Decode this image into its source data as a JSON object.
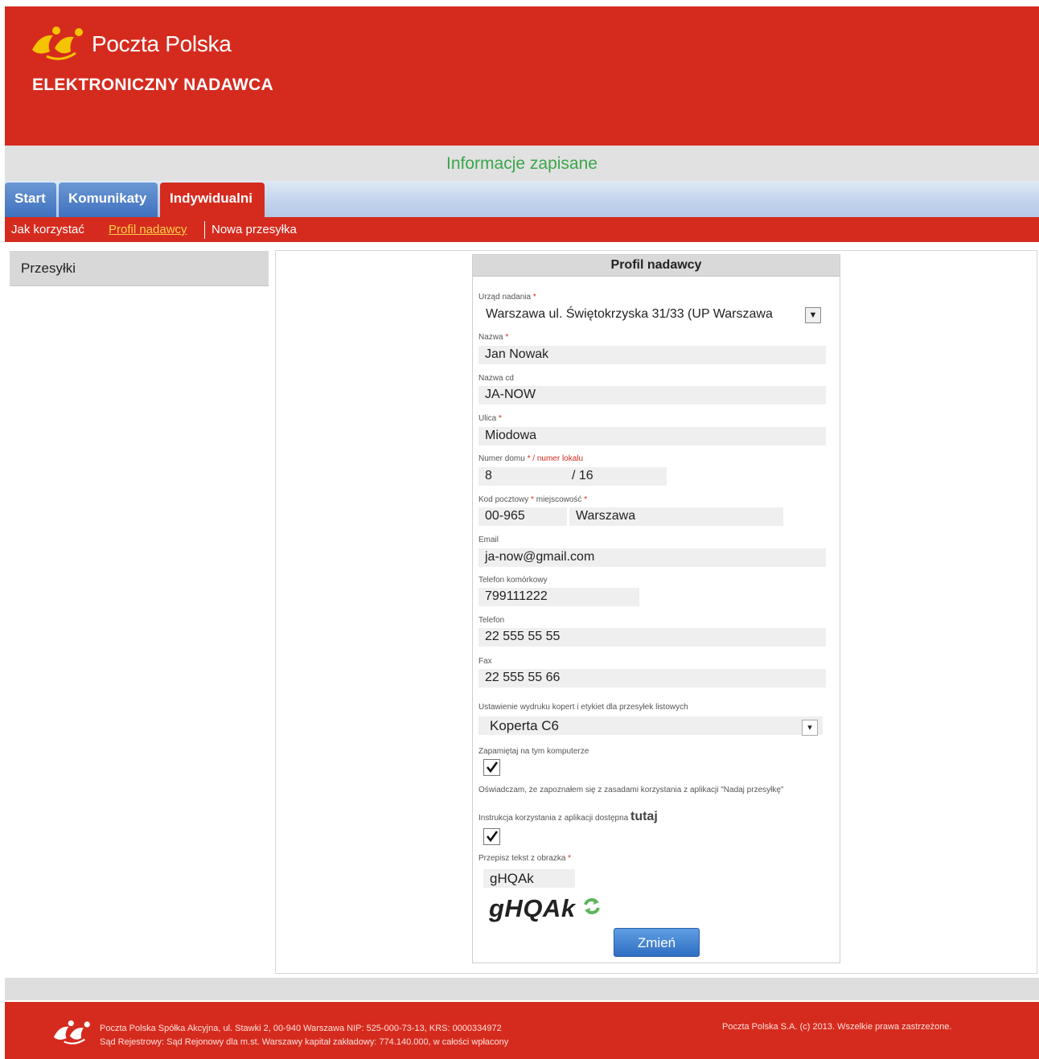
{
  "header": {
    "brand_name": "Poczta Polska",
    "app_title": "ELEKTRONICZNY NADAWCA"
  },
  "status": {
    "message": "Informacje zapisane"
  },
  "tabs": [
    {
      "label": "Start"
    },
    {
      "label": "Komunikaty"
    },
    {
      "label": "Indywidualni",
      "active": true
    }
  ],
  "subnav": [
    {
      "label": "Jak korzystać"
    },
    {
      "label": "Profil nadawcy",
      "active": true
    },
    {
      "label": "Nowa przesyłka"
    }
  ],
  "sidebar": {
    "title": "Przesyłki"
  },
  "form": {
    "title": "Profil nadawcy",
    "urzad": {
      "label": "Urząd nadania",
      "value": "Warszawa ul. Świętokrzyska 31/33 (UP Warszawa"
    },
    "nazwa": {
      "label": "Nazwa",
      "value": "Jan Nowak"
    },
    "nazwa_cd": {
      "label": "Nazwa cd",
      "value": "JA-NOW"
    },
    "ulica": {
      "label": "Ulica",
      "value": "Miodowa"
    },
    "numer": {
      "label_a": "Numer domu",
      "label_b": "/ numer lokalu",
      "dom": "8",
      "lokal": "16",
      "slash": "/"
    },
    "kod": {
      "label_a": "Kod pocztowy",
      "label_b": "miejscowość",
      "kod": "00-965",
      "miejscowosc": "Warszawa"
    },
    "email": {
      "label": "Email",
      "value": "ja-now@gmail.com"
    },
    "telefon_kom": {
      "label": "Telefon komórkowy",
      "value": "799111222"
    },
    "telefon": {
      "label": "Telefon",
      "value": "22 555 55 55"
    },
    "fax": {
      "label": "Fax",
      "value": "22 555 55 66"
    },
    "wydruk": {
      "label": "Ustawienie wydruku kopert i etykiet dla przesyłek listowych",
      "value": "Koperta C6"
    },
    "zapamietaj": {
      "label": "Zapamiętaj na tym komputerze",
      "checked": true
    },
    "oswiadczam": {
      "label": "Oświadczam, że zapoznałem się z zasadami korzystania z aplikacji \"Nadaj przesyłkę\""
    },
    "instrukcja": {
      "label": "Instrukcja korzystania z aplikacji dostępna",
      "link": "tutaj",
      "checked": true
    },
    "captcha": {
      "label": "Przepisz tekst z obrazka",
      "value": "gHQAk",
      "image_text": "gHQAk"
    },
    "submit_label": "Zmień",
    "required_mark": "*"
  },
  "footer": {
    "line1": "Poczta Polska Spółka Akcyjna, ul. Stawki 2, 00-940 Warszawa NIP: 525-000-73-13, KRS: 0000334972",
    "line2": "Sąd Rejestrowy: Sąd Rejonowy dla m.st. Warszawy kapitał zakładowy: 774.140.000, w całości wpłacony",
    "copyright": "Poczta Polska S.A. (c) 2013. Wszelkie prawa zastrzeżone."
  },
  "colors": {
    "brand_red": "#d52b1e",
    "logo_yellow": "#f5c400",
    "status_green": "#3aa64a",
    "tab_blue": "#3f71be",
    "active_link": "#ffd24a"
  },
  "icons": [
    "poczta-polska-logo-icon",
    "select-arrow-icon",
    "checkbox-check-icon",
    "refresh-captcha-icon"
  ]
}
